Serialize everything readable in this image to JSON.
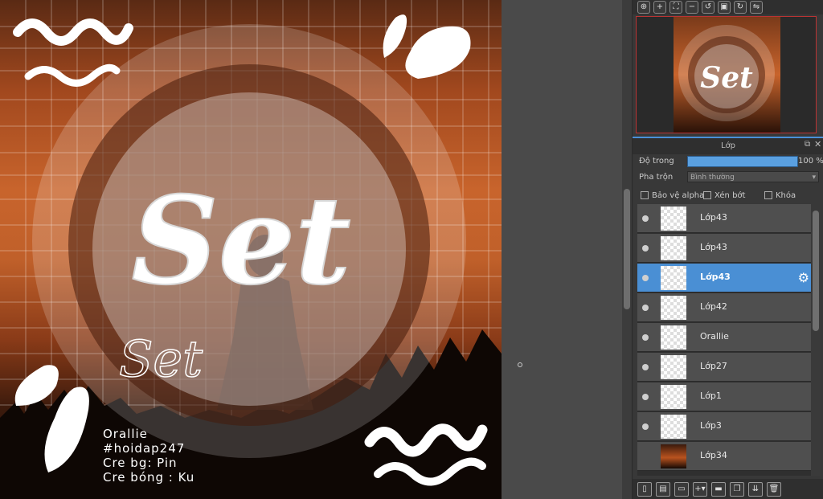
{
  "artwork": {
    "title_main": "Set",
    "title_outline": "Set",
    "info_lines": [
      "Orallie",
      "#hoidap247",
      "Cre bg: Pin",
      "Cre bóng : Ku"
    ]
  },
  "navigator": {
    "icons": [
      "zoom-fit-icon",
      "zoom-in-icon",
      "fit-window-icon",
      "zoom-out-icon",
      "rotate-left-icon",
      "fullscreen-icon",
      "rotate-right-icon",
      "flip-icon"
    ]
  },
  "layer_panel": {
    "title": "Lớp",
    "opacity_label": "Độ trong",
    "opacity_value": "100 %",
    "opacity_fraction": 1.0,
    "blend_label": "Pha trộn",
    "blend_value": "Bình thường",
    "protect_alpha_label": "Bảo vệ alpha",
    "clip_label": "Xén bớt",
    "lock_label": "Khóa",
    "layers": [
      {
        "name": "Lớp43",
        "visible": true,
        "selected": false
      },
      {
        "name": "Lớp43",
        "visible": true,
        "selected": false
      },
      {
        "name": "Lớp43",
        "visible": true,
        "selected": true
      },
      {
        "name": "Lớp42",
        "visible": true,
        "selected": false
      },
      {
        "name": "Orallie",
        "visible": true,
        "selected": false
      },
      {
        "name": "Lớp27",
        "visible": true,
        "selected": false
      },
      {
        "name": "Lớp1",
        "visible": true,
        "selected": false
      },
      {
        "name": "Lớp3",
        "visible": true,
        "selected": false
      },
      {
        "name": "Lớp34",
        "visible": false,
        "selected": false
      }
    ]
  },
  "bottom_icons": [
    "new-layer-icon",
    "new-layer-copy-icon",
    "new-file-icon",
    "add-layer-menu-icon",
    "folder-icon",
    "duplicate-icon",
    "merge-icon",
    "delete-icon"
  ]
}
